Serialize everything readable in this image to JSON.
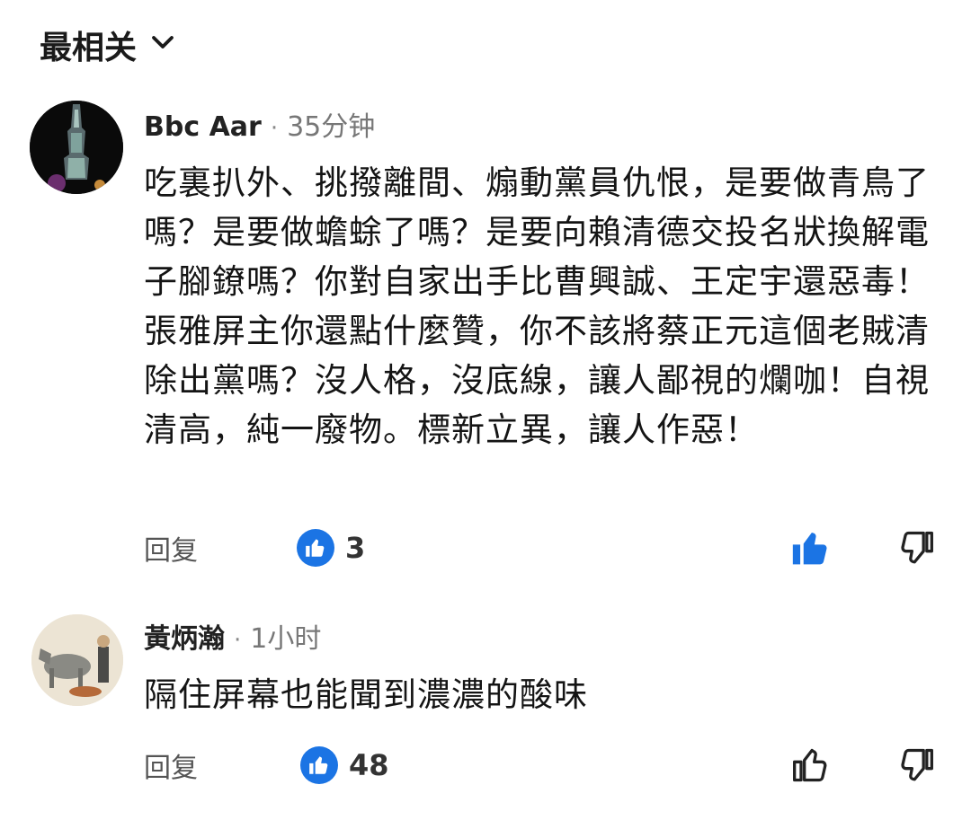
{
  "sort": {
    "label": "最相关"
  },
  "comments": [
    {
      "author": "Bbc Aar",
      "separator": "·",
      "time": "35分钟",
      "text": "吃裏扒外、挑撥離間、煽動黨員仇恨，是要做青鳥了嗎？是要做蟾蜍了嗎？是要向賴清德交投名狀換解電子腳鐐嗎？你對自家出手比曹興誠、王定宇還惡毒！張雅屏主你還點什麼贊，你不該將蔡正元這個老賊清除出黨嗎？沒人格，沒底線，讓人鄙視的爛咖！自視清高，純一廢物。標新立異，讓人作惡！",
      "reply_label": "回复",
      "like_count": "3",
      "liked": true
    },
    {
      "author": "黃炳瀚",
      "separator": "·",
      "time": "1小时",
      "text": "隔住屏幕也能聞到濃濃的酸味",
      "reply_label": "回复",
      "like_count": "48",
      "liked": false
    }
  ],
  "colors": {
    "accent": "#1b74e4",
    "text": "#141414",
    "muted": "#777777"
  }
}
